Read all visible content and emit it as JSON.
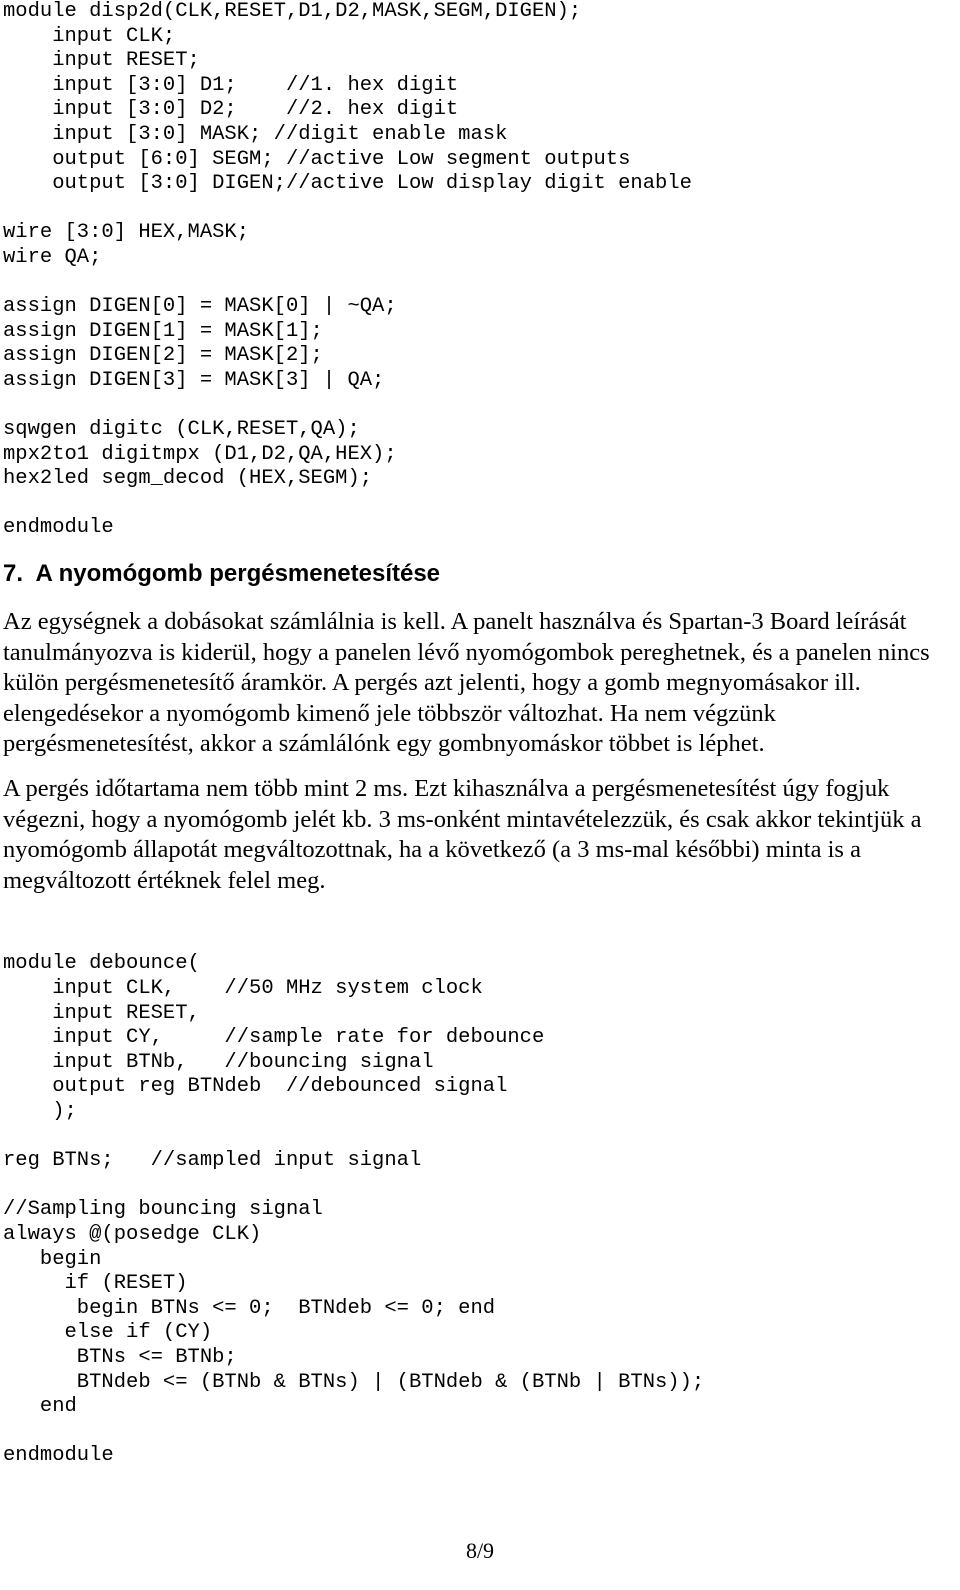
{
  "document": {
    "page_label": "8/9"
  },
  "code_block_1": {
    "name": "disp2d-module-source",
    "lines": [
      "module disp2d(CLK,RESET,D1,D2,MASK,SEGM,DIGEN);",
      "    input CLK;",
      "    input RESET;",
      "    input [3:0] D1;    //1. hex digit",
      "    input [3:0] D2;    //2. hex digit",
      "    input [3:0] MASK; //digit enable mask",
      "    output [6:0] SEGM; //active Low segment outputs",
      "    output [3:0] DIGEN;//active Low display digit enable",
      "",
      "wire [3:0] HEX,MASK;",
      "wire QA;",
      "",
      "assign DIGEN[0] = MASK[0] | ~QA;",
      "assign DIGEN[1] = MASK[1];",
      "assign DIGEN[2] = MASK[2];",
      "assign DIGEN[3] = MASK[3] | QA;",
      "",
      "sqwgen digitc (CLK,RESET,QA);",
      "mpx2to1 digitmpx (D1,D2,QA,HEX);",
      "hex2led segm_decod (HEX,SEGM);",
      "",
      "endmodule"
    ]
  },
  "section": {
    "heading": "7.  A nyomógomb pergésmenetesítése",
    "paragraphs": [
      "Az egységnek a dobásokat számlálnia is kell. A panelt használva és Spartan-3 Board leírását tanulmányozva is kiderül, hogy a panelen lévő nyomógombok pereghetnek, és a panelen nincs külön pergésmenetesítő áramkör. A pergés azt jelenti, hogy a gomb megnyomásakor ill. elengedésekor a nyomógomb kimenő jele többször változhat. Ha nem végzünk pergésmenetesítést, akkor a számlálónk egy gombnyomáskor többet is léphet.",
      "A pergés időtartama nem több mint 2 ms. Ezt kihasználva a pergésmenetesítést úgy fogjuk végezni, hogy a nyomógomb jelét kb. 3 ms-onként mintavételezzük, és csak akkor tekintjük a nyomógomb állapotát megváltozottnak, ha a következő (a 3 ms-mal későbbi) minta is a megváltozott értéknek felel meg."
    ]
  },
  "code_block_2": {
    "name": "debounce-module-source",
    "lines": [
      "module debounce(",
      "    input CLK,    //50 MHz system clock",
      "    input RESET,",
      "    input CY,     //sample rate for debounce",
      "    input BTNb,   //bouncing signal",
      "    output reg BTNdeb  //debounced signal",
      "    );",
      "",
      "reg BTNs;   //sampled input signal",
      "",
      "//Sampling bouncing signal",
      "always @(posedge CLK)",
      "   begin",
      "     if (RESET)",
      "      begin BTNs <= 0;  BTNdeb <= 0; end",
      "     else if (CY)",
      "      BTNs <= BTNb;",
      "      BTNdeb <= (BTNb & BTNs) | (BTNdeb & (BTNb | BTNs));",
      "   end",
      "",
      "endmodule"
    ]
  }
}
